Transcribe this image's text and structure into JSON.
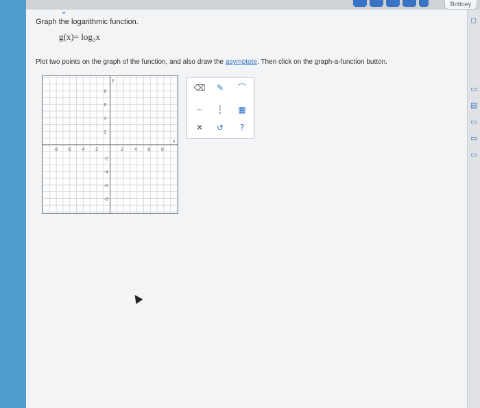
{
  "header": {
    "user_name": "Brittney"
  },
  "question": {
    "instruction": "Graph the logarithmic function.",
    "equation": "g(x)= log₃x",
    "prompt_before_link": "Plot two points on the graph of the function, and also draw the ",
    "prompt_link": "asymptote",
    "prompt_after_link": ". Then click on the graph-a-function button."
  },
  "graph": {
    "x_label": "x",
    "y_label": "y",
    "x_ticks": [
      "-8",
      "-6",
      "-4",
      "-2",
      "2",
      "4",
      "6",
      "8"
    ],
    "y_ticks": [
      "8",
      "6",
      "4",
      "2",
      "-2",
      "-4",
      "-6",
      "-8"
    ]
  },
  "tools": {
    "row1": [
      "eraser-icon",
      "pencil-icon",
      "curve-icon"
    ],
    "row2": [
      "dashed-line-icon",
      "vertical-line-icon",
      "graph-function-icon"
    ],
    "row3": [
      "clear-icon",
      "undo-icon",
      "help-icon"
    ],
    "help_label": "?"
  }
}
